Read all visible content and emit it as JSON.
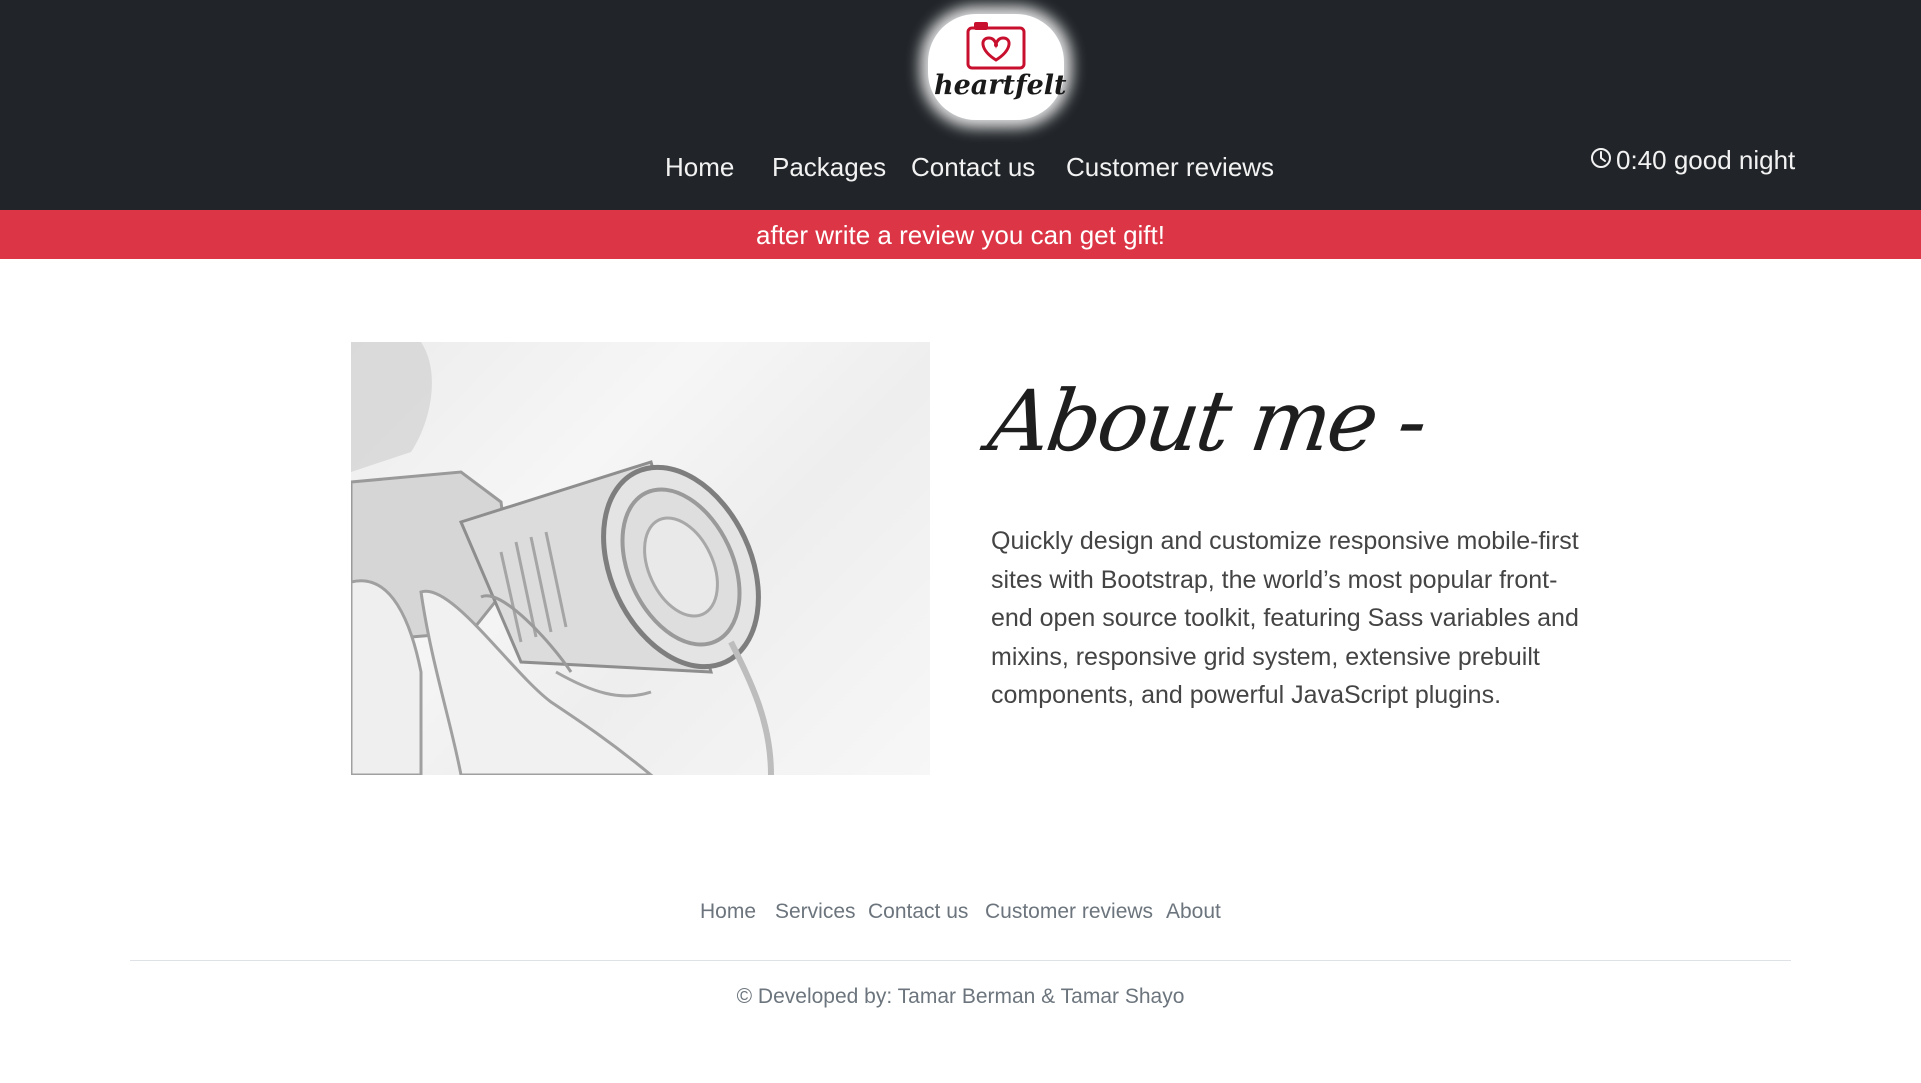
{
  "header": {
    "logo_text": "heartfelt",
    "nav": [
      "Home",
      "Packages",
      "Contact us",
      "Customer reviews"
    ],
    "clock": {
      "icon": "clock-icon",
      "text": "0:40 good night"
    }
  },
  "banner": {
    "text": "after write a review you can get gift!"
  },
  "about": {
    "title": "About me -",
    "paragraph_lines": [
      "Quickly design and customize responsive mobile-first",
      "sites with Bootstrap, the world’s most popular front-",
      "end open source toolkit, featuring Sass variables and",
      "mixins, responsive grid system, extensive prebuilt",
      "components, and powerful JavaScript plugins."
    ]
  },
  "footer": {
    "links": [
      "Home",
      "Services",
      "Contact us",
      "Customer reviews",
      "About"
    ],
    "copyright": "© Developed by: Tamar Berman & Tamar Shayo"
  },
  "colors": {
    "header_bg": "#212529",
    "banner_bg": "#dc3545",
    "footer_text": "#6c757d",
    "logo_accent": "#c8102e"
  }
}
